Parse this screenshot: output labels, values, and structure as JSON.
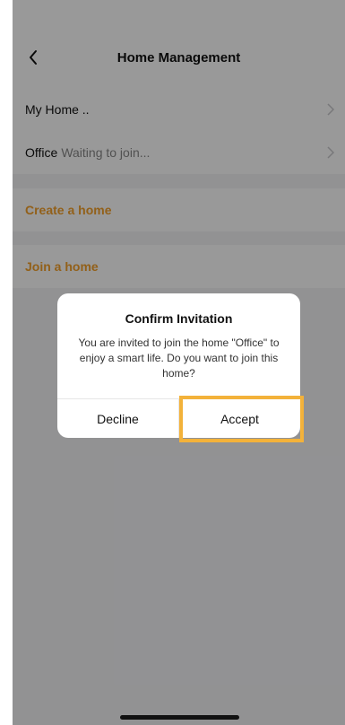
{
  "header": {
    "title": "Home Management"
  },
  "homes": [
    {
      "name": "My Home ..",
      "status": ""
    },
    {
      "name": "Office",
      "status": "Waiting to join..."
    }
  ],
  "actions": {
    "create": "Create a home",
    "join": "Join a home"
  },
  "dialog": {
    "title": "Confirm Invitation",
    "message": "You are invited to join the home \"Office\" to enjoy a smart life. Do you want to join this home?",
    "decline_label": "Decline",
    "accept_label": "Accept"
  },
  "colors": {
    "accent": "#f3a02b",
    "highlight": "#f3b23a"
  }
}
